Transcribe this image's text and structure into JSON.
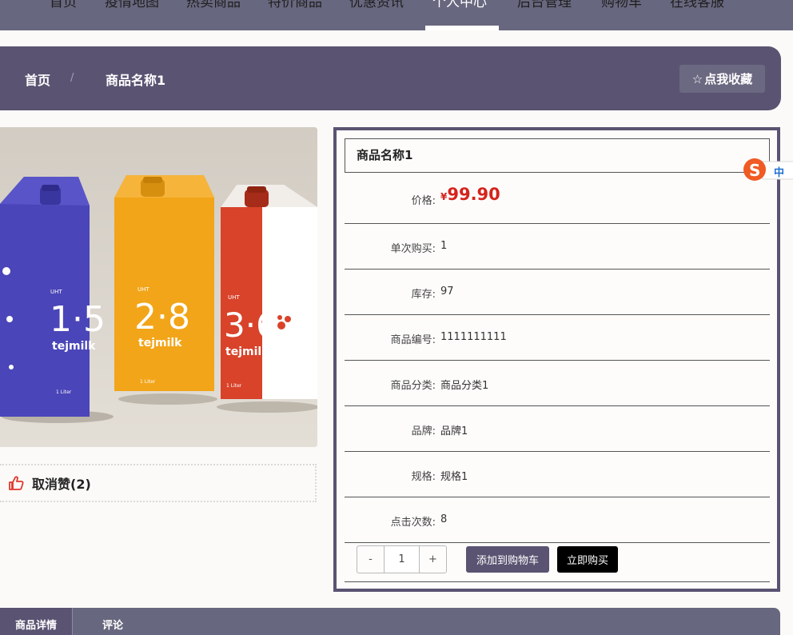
{
  "nav": {
    "items": [
      "首页",
      "疫情地图",
      "热卖商品",
      "特价商品",
      "优惠资讯",
      "个人中心",
      "后台管理",
      "购物车",
      "在线客服"
    ],
    "active_index": 5
  },
  "breadcrumb": {
    "home": "首页",
    "separator": "/",
    "current": "商品名称1",
    "favorite_label": "点我收藏",
    "favorite_icon": "☆"
  },
  "like": {
    "label": "取消赞(2)",
    "icon": "thumbs-up-icon"
  },
  "product": {
    "title": "商品名称1",
    "price_label": "价格:",
    "price_currency": "¥",
    "price_value": "99.90",
    "fields": [
      {
        "label": "单次购买:",
        "value": "1"
      },
      {
        "label": "库存:",
        "value": "97"
      },
      {
        "label": "商品编号:",
        "value": "1111111111"
      },
      {
        "label": "商品分类:",
        "value": "商品分类1"
      },
      {
        "label": "品牌:",
        "value": "品牌1"
      },
      {
        "label": "规格:",
        "value": "规格1"
      },
      {
        "label": "点击次数:",
        "value": "8"
      }
    ],
    "quantity": "1",
    "minus": "-",
    "plus": "+",
    "add_to_cart": "添加到购物车",
    "buy_now": "立即购买"
  },
  "photo": {
    "cartons": [
      {
        "num": "1·5",
        "brand": "tejmilk",
        "color": "#4a45b8"
      },
      {
        "num": "2·8",
        "brand": "tejmilk",
        "color": "#f2a519"
      },
      {
        "num": "3·6",
        "brand": "tejmilk",
        "color": "#d8432a"
      }
    ],
    "volume": "1 Liter",
    "uht": "UHT"
  },
  "ime": {
    "label": "中"
  },
  "tabs": [
    "商品详情",
    "评论"
  ],
  "colors": {
    "primary": "#5b5372",
    "nav": "#67677f",
    "price": "#d4241b",
    "buy": "#000000"
  }
}
